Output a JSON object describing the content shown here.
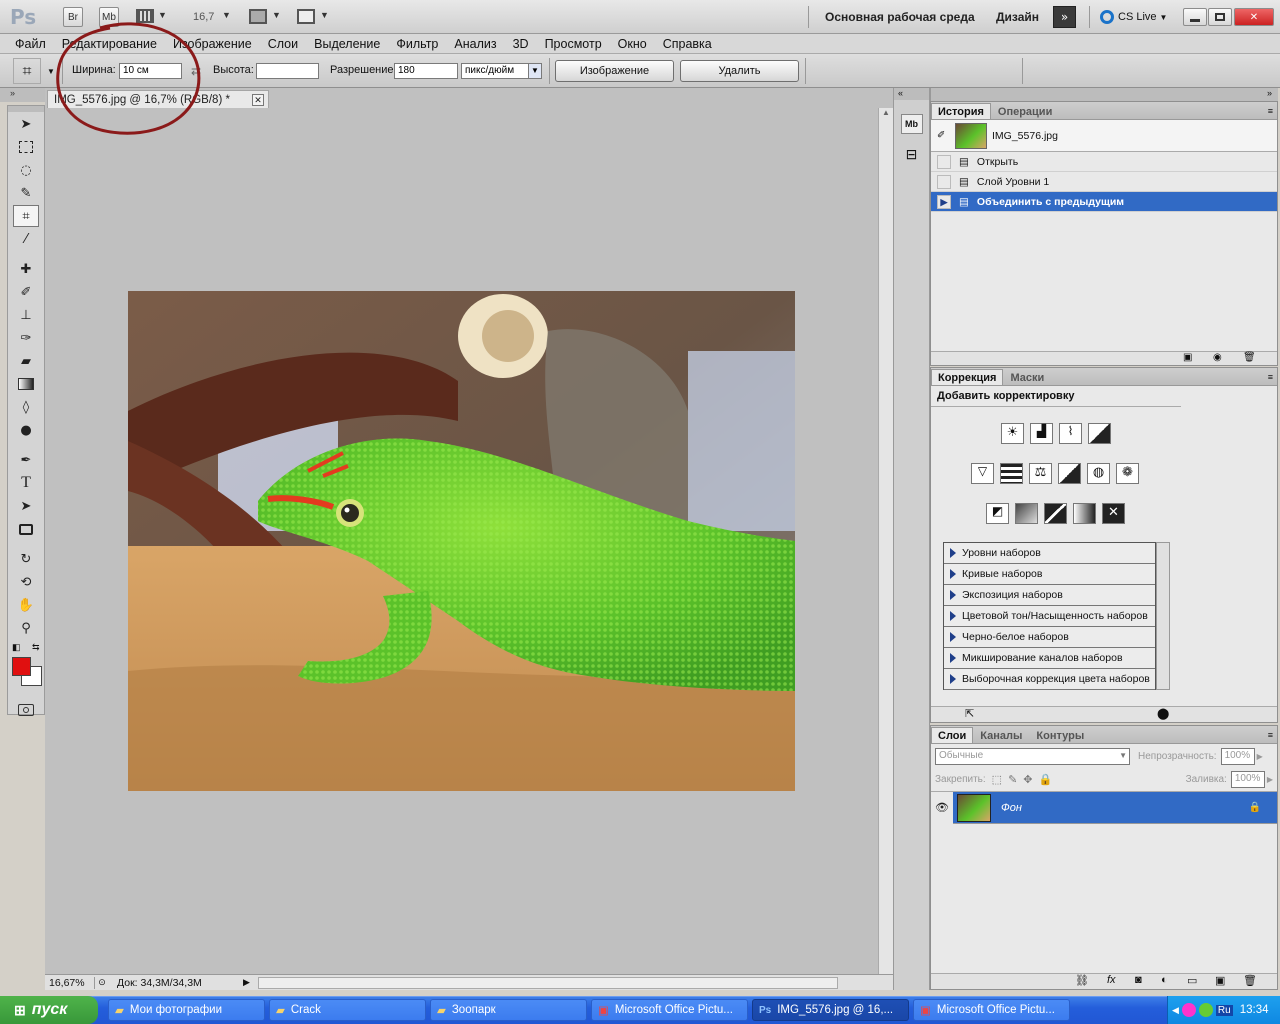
{
  "app": {
    "logo": "Ps",
    "launch_bridge": "Br",
    "launch_minibridge": "Mb",
    "zoom_value": "16,7",
    "workspace_essentials": "Основная рабочая среда",
    "workspace_design": "Дизайн",
    "cs_live": "CS Live"
  },
  "menu": [
    "Файл",
    "Редактирование",
    "Изображение",
    "Слои",
    "Выделение",
    "Фильтр",
    "Анализ",
    "3D",
    "Просмотр",
    "Окно",
    "Справка"
  ],
  "options": {
    "width_label": "Ширина:",
    "width_value": "10 см",
    "height_label": "Высота:",
    "height_value": "",
    "resolution_label": "Разрешение:",
    "resolution_value": "180",
    "resolution_unit": "пикс/дюйм",
    "image_button": "Изображение",
    "delete_button": "Удалить"
  },
  "document": {
    "tab_title": "IMG_5576.jpg @ 16,7% (RGB/8) *",
    "status_zoom": "16,67%",
    "status_doc": "Док: 34,3M/34,3M"
  },
  "history": {
    "tabs": [
      "История",
      "Операции"
    ],
    "snapshot_name": "IMG_5576.jpg",
    "items": [
      {
        "label": "Открыть",
        "selected": false
      },
      {
        "label": "Слой Уровни 1",
        "selected": false
      },
      {
        "label": "Объединить с предыдущим",
        "selected": true
      }
    ]
  },
  "adjustments": {
    "tabs": [
      "Коррекция",
      "Маски"
    ],
    "header": "Добавить корректировку",
    "presets": [
      "Уровни наборов",
      "Кривые наборов",
      "Экспозиция наборов",
      "Цветовой тон/Насыщенность наборов",
      "Черно-белое наборов",
      "Микширование каналов наборов",
      "Выборочная коррекция цвета наборов"
    ]
  },
  "layers": {
    "tabs": [
      "Слои",
      "Каналы",
      "Контуры"
    ],
    "blend_mode": "Обычные",
    "opacity_label": "Непрозрачность:",
    "opacity_value": "100%",
    "lock_label": "Закрепить:",
    "fill_label": "Заливка:",
    "fill_value": "100%",
    "layer_name": "Фон"
  },
  "colors": {
    "foreground": "#e01010",
    "background": "#ffffff",
    "selection": "#316ac5",
    "annotation": "#8b1a1a"
  },
  "taskbar": {
    "start": "пуск",
    "tasks": [
      {
        "label": "Мои фотографии",
        "icon": "folder-icon",
        "active": false
      },
      {
        "label": "Crack",
        "icon": "folder-icon",
        "active": false
      },
      {
        "label": "Зоопарк",
        "icon": "folder-icon",
        "active": false
      },
      {
        "label": "Microsoft Office Pictu...",
        "icon": "picture-manager-icon",
        "active": false
      },
      {
        "label": "IMG_5576.jpg @ 16,...",
        "icon": "photoshop-icon",
        "active": true
      },
      {
        "label": "Microsoft Office Pictu...",
        "icon": "picture-manager-icon",
        "active": false
      }
    ],
    "language": "Ru",
    "clock": "13:34"
  }
}
